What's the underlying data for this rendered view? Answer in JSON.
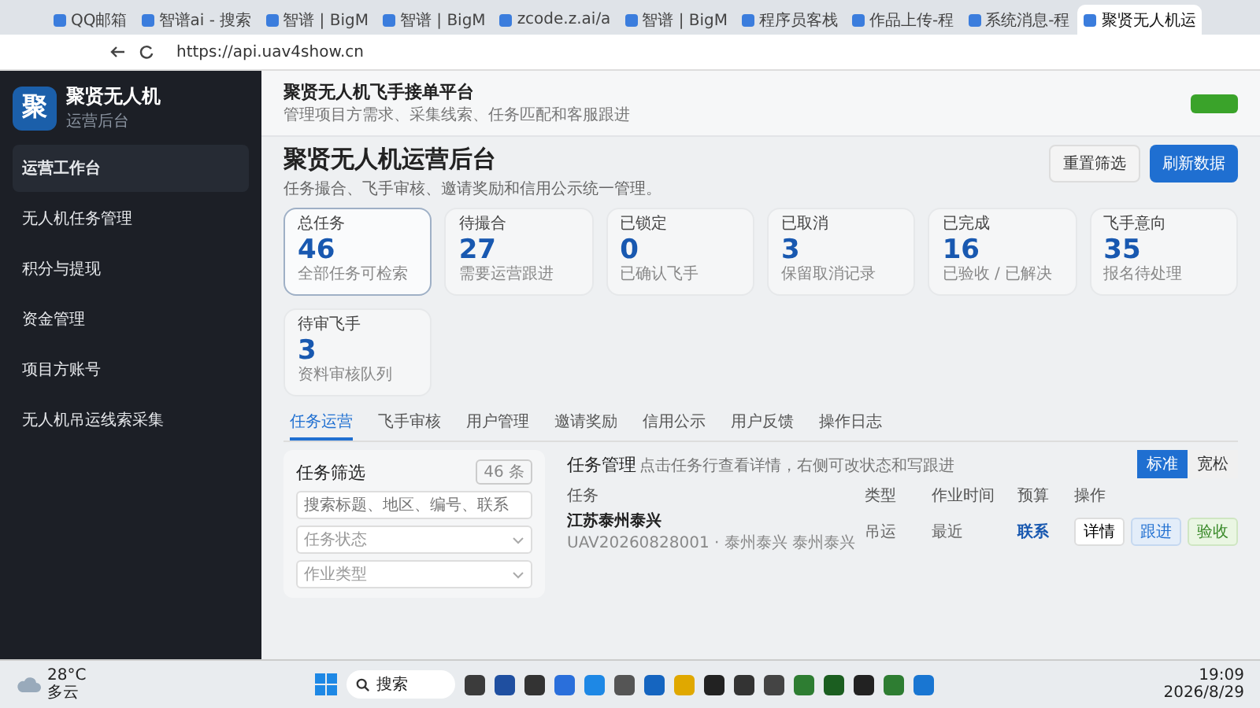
{
  "browser": {
    "tabs": [
      {
        "label": "QQ邮箱",
        "selected": false
      },
      {
        "label": "智谱ai - 搜索",
        "selected": false
      },
      {
        "label": "智谱 | BigM",
        "selected": false
      },
      {
        "label": "智谱 | BigM",
        "selected": false
      },
      {
        "label": "zcode.z.ai/a",
        "selected": false
      },
      {
        "label": "智谱 | BigM",
        "selected": false
      },
      {
        "label": "程序员客栈",
        "selected": false
      },
      {
        "label": "作品上传-程",
        "selected": false
      },
      {
        "label": "系统消息-程",
        "selected": false
      },
      {
        "label": "聚贤无人机运",
        "selected": true
      }
    ],
    "url": "https://api.uav4show.cn"
  },
  "sidebar": {
    "logo": "聚",
    "name": "聚贤无人机",
    "subtitle": "运营后台",
    "items": [
      {
        "label": "运营工作台",
        "selected": true
      },
      {
        "label": "无人机任务管理",
        "selected": false
      },
      {
        "label": "积分与提现",
        "selected": false
      },
      {
        "label": "资金管理",
        "selected": false
      },
      {
        "label": "项目方账号",
        "selected": false
      },
      {
        "label": "无人机吊运线索采集",
        "selected": false
      }
    ]
  },
  "header": {
    "title": "聚贤无人机飞手接单平台",
    "subtitle": "管理项目方需求、采集线索、任务匹配和客服跟进"
  },
  "hero": {
    "title": "聚贤无人机运营后台",
    "subtitle": "任务撮合、飞手审核、邀请奖励和信用公示统一管理。",
    "buttons": [
      {
        "label": "重置筛选",
        "kind": "secondary"
      },
      {
        "label": "刷新数据",
        "kind": "primary"
      }
    ]
  },
  "stats": [
    {
      "label": "总任务",
      "value": "46",
      "note": "全部任务可检索",
      "selected": true
    },
    {
      "label": "待撮合",
      "value": "27",
      "note": "需要运营跟进",
      "selected": false
    },
    {
      "label": "已锁定",
      "value": "0",
      "note": "已确认飞手",
      "selected": false
    },
    {
      "label": "已取消",
      "value": "3",
      "note": "保留取消记录",
      "selected": false
    },
    {
      "label": "已完成",
      "value": "16",
      "note": "已验收 / 已解决",
      "selected": false
    },
    {
      "label": "飞手意向",
      "value": "35",
      "note": "报名待处理",
      "selected": false
    },
    {
      "label": "待审飞手",
      "value": "3",
      "note": "资料审核队列",
      "selected": false
    }
  ],
  "tabs": [
    {
      "label": "任务运营",
      "selected": true
    },
    {
      "label": "飞手审核",
      "selected": false
    },
    {
      "label": "用户管理",
      "selected": false
    },
    {
      "label": "邀请奖励",
      "selected": false
    },
    {
      "label": "信用公示",
      "selected": false
    },
    {
      "label": "用户反馈",
      "selected": false
    },
    {
      "label": "操作日志",
      "selected": false
    }
  ],
  "filter": {
    "title": "任务筛选",
    "count": "46 条",
    "search": {
      "placeholder": "搜索标题、地区、编号、联系"
    },
    "selects": [
      {
        "placeholder": "任务状态"
      },
      {
        "placeholder": "作业类型"
      }
    ]
  },
  "tasks": {
    "title": "任务管理",
    "hint": "点击任务行查看详情，右侧可改状态和写跟进",
    "density": [
      {
        "label": "标准",
        "selected": true
      },
      {
        "label": "宽松",
        "selected": false
      }
    ],
    "columns": [
      "任务",
      "类型",
      "作业时间",
      "预算",
      "操作"
    ],
    "rows": [
      {
        "title": "江苏泰州泰兴",
        "sub": "UAV20260828001 · 泰州泰兴 泰州泰兴",
        "type": "吊运",
        "time": "最近",
        "contact": "联系",
        "actions": [
          {
            "label": "详情",
            "kind": "plain"
          },
          {
            "label": "跟进",
            "kind": "info"
          },
          {
            "label": "验收",
            "kind": "success"
          }
        ]
      }
    ]
  },
  "taskbar": {
    "temperature": "28°C",
    "weather": "多云",
    "search": "搜索",
    "time": "19:09",
    "date": "2026/8/29"
  }
}
